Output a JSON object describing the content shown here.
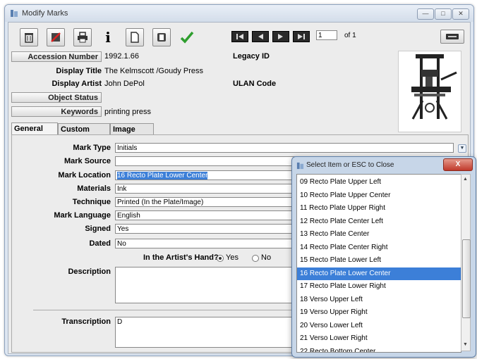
{
  "window": {
    "title": "Modify Marks"
  },
  "nav": {
    "page": "1",
    "of_text": "of 1"
  },
  "header": {
    "accession_label": "Accession Number",
    "accession_value": "1992.1.66",
    "legacy_label": "Legacy ID",
    "display_title_label": "Display Title",
    "display_title_value": "The Kelmscott /Goudy Press",
    "display_artist_label": "Display Artist",
    "display_artist_value": "John DePol",
    "ulan_label": "ULAN Code",
    "object_status_label": "Object Status",
    "keywords_label": "Keywords",
    "keywords_value": "printing press"
  },
  "tabs": [
    "General Info",
    "Custom Fields",
    "Image List"
  ],
  "form": {
    "mark_type_label": "Mark Type",
    "mark_type_value": "Initials",
    "mark_source_label": "Mark Source",
    "mark_source_value": "",
    "mark_location_label": "Mark Location",
    "mark_location_value": "16 Recto Plate Lower Center",
    "materials_label": "Materials",
    "materials_value": "Ink",
    "technique_label": "Technique",
    "technique_value": "Printed (In the Plate/Image)",
    "mark_language_label": "Mark Language",
    "mark_language_value": "English",
    "signed_label": "Signed",
    "signed_value": "Yes",
    "dated_label": "Dated",
    "dated_value": "No",
    "artists_hand_label": "In the Artist's Hand?",
    "yes_label": "Yes",
    "no_label": "No",
    "description_label": "Description",
    "transcription_label": "Transcription",
    "transcription_value": "D"
  },
  "popup": {
    "title": "Select Item or ESC to Close",
    "close": "X",
    "selected_index": 7,
    "items": [
      "09 Recto Plate Upper Left",
      "10 Recto Plate Upper Center",
      "11 Recto Plate Upper Right",
      "12 Recto Plate Center Left",
      "13 Recto Plate Center",
      "14 Recto Plate Center Right",
      "15 Recto Plate Lower Left",
      "16 Recto Plate Lower Center",
      "17 Recto Plate Lower Right",
      "18 Verso Upper Left",
      "19 Verso Upper Right",
      "20 Verso Lower Left",
      "21 Verso Lower Right",
      "22 Recto Bottom Center"
    ]
  },
  "colors": {
    "selection": "#3c7fd8",
    "close_red": "#c0392b",
    "check_green": "#2e9e2e"
  }
}
